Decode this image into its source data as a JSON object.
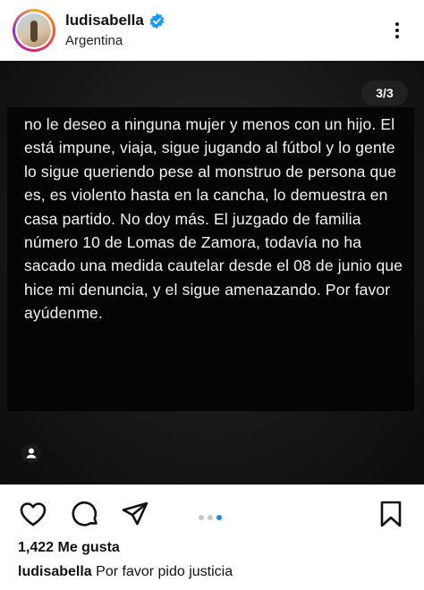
{
  "header": {
    "username": "ludisabella",
    "location": "Argentina",
    "verified_icon": "verified-badge-icon",
    "more_icon": "more-options-icon"
  },
  "post": {
    "page_counter": "3/3",
    "text": "no le deseo a ninguna mujer y menos con un hijo. El está impune, viaja, sigue jugando al fútbol y lo gente lo sigue queriendo pese al monstruo de persona que es, es violento hasta en la cancha, lo demuestra en casa partido. No doy más. El juzgado de familia número 10 de Lomas de Zamora, todavía no ha sacado una medida cautelar desde el 08 de junio que hice mi denuncia, y el sigue amenazando. Por favor ayúdenme."
  },
  "actions": {
    "icons": [
      "heart-icon",
      "comment-icon",
      "share-icon",
      "bookmark-icon"
    ],
    "carousel_total": 3,
    "carousel_active": 3,
    "accent_color": "#1e88e5"
  },
  "likes": "1,422 Me gusta",
  "caption": {
    "username": "ludisabella",
    "text": "Por favor pido justicia"
  }
}
